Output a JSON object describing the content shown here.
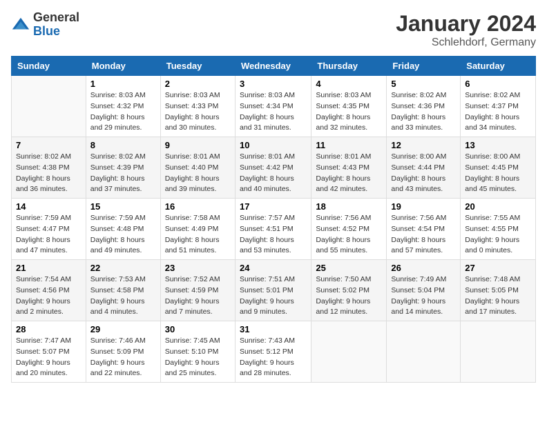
{
  "header": {
    "logo": {
      "general": "General",
      "blue": "Blue"
    },
    "title": "January 2024",
    "location": "Schlehdorf, Germany"
  },
  "days_of_week": [
    "Sunday",
    "Monday",
    "Tuesday",
    "Wednesday",
    "Thursday",
    "Friday",
    "Saturday"
  ],
  "weeks": [
    [
      {
        "day": "",
        "empty": true
      },
      {
        "day": "1",
        "sunrise": "8:03 AM",
        "sunset": "4:32 PM",
        "daylight": "8 hours and 29 minutes."
      },
      {
        "day": "2",
        "sunrise": "8:03 AM",
        "sunset": "4:33 PM",
        "daylight": "8 hours and 30 minutes."
      },
      {
        "day": "3",
        "sunrise": "8:03 AM",
        "sunset": "4:34 PM",
        "daylight": "8 hours and 31 minutes."
      },
      {
        "day": "4",
        "sunrise": "8:03 AM",
        "sunset": "4:35 PM",
        "daylight": "8 hours and 32 minutes."
      },
      {
        "day": "5",
        "sunrise": "8:02 AM",
        "sunset": "4:36 PM",
        "daylight": "8 hours and 33 minutes."
      },
      {
        "day": "6",
        "sunrise": "8:02 AM",
        "sunset": "4:37 PM",
        "daylight": "8 hours and 34 minutes."
      }
    ],
    [
      {
        "day": "7",
        "sunrise": "8:02 AM",
        "sunset": "4:38 PM",
        "daylight": "8 hours and 36 minutes."
      },
      {
        "day": "8",
        "sunrise": "8:02 AM",
        "sunset": "4:39 PM",
        "daylight": "8 hours and 37 minutes."
      },
      {
        "day": "9",
        "sunrise": "8:01 AM",
        "sunset": "4:40 PM",
        "daylight": "8 hours and 39 minutes."
      },
      {
        "day": "10",
        "sunrise": "8:01 AM",
        "sunset": "4:42 PM",
        "daylight": "8 hours and 40 minutes."
      },
      {
        "day": "11",
        "sunrise": "8:01 AM",
        "sunset": "4:43 PM",
        "daylight": "8 hours and 42 minutes."
      },
      {
        "day": "12",
        "sunrise": "8:00 AM",
        "sunset": "4:44 PM",
        "daylight": "8 hours and 43 minutes."
      },
      {
        "day": "13",
        "sunrise": "8:00 AM",
        "sunset": "4:45 PM",
        "daylight": "8 hours and 45 minutes."
      }
    ],
    [
      {
        "day": "14",
        "sunrise": "7:59 AM",
        "sunset": "4:47 PM",
        "daylight": "8 hours and 47 minutes."
      },
      {
        "day": "15",
        "sunrise": "7:59 AM",
        "sunset": "4:48 PM",
        "daylight": "8 hours and 49 minutes."
      },
      {
        "day": "16",
        "sunrise": "7:58 AM",
        "sunset": "4:49 PM",
        "daylight": "8 hours and 51 minutes."
      },
      {
        "day": "17",
        "sunrise": "7:57 AM",
        "sunset": "4:51 PM",
        "daylight": "8 hours and 53 minutes."
      },
      {
        "day": "18",
        "sunrise": "7:56 AM",
        "sunset": "4:52 PM",
        "daylight": "8 hours and 55 minutes."
      },
      {
        "day": "19",
        "sunrise": "7:56 AM",
        "sunset": "4:54 PM",
        "daylight": "8 hours and 57 minutes."
      },
      {
        "day": "20",
        "sunrise": "7:55 AM",
        "sunset": "4:55 PM",
        "daylight": "9 hours and 0 minutes."
      }
    ],
    [
      {
        "day": "21",
        "sunrise": "7:54 AM",
        "sunset": "4:56 PM",
        "daylight": "9 hours and 2 minutes."
      },
      {
        "day": "22",
        "sunrise": "7:53 AM",
        "sunset": "4:58 PM",
        "daylight": "9 hours and 4 minutes."
      },
      {
        "day": "23",
        "sunrise": "7:52 AM",
        "sunset": "4:59 PM",
        "daylight": "9 hours and 7 minutes."
      },
      {
        "day": "24",
        "sunrise": "7:51 AM",
        "sunset": "5:01 PM",
        "daylight": "9 hours and 9 minutes."
      },
      {
        "day": "25",
        "sunrise": "7:50 AM",
        "sunset": "5:02 PM",
        "daylight": "9 hours and 12 minutes."
      },
      {
        "day": "26",
        "sunrise": "7:49 AM",
        "sunset": "5:04 PM",
        "daylight": "9 hours and 14 minutes."
      },
      {
        "day": "27",
        "sunrise": "7:48 AM",
        "sunset": "5:05 PM",
        "daylight": "9 hours and 17 minutes."
      }
    ],
    [
      {
        "day": "28",
        "sunrise": "7:47 AM",
        "sunset": "5:07 PM",
        "daylight": "9 hours and 20 minutes."
      },
      {
        "day": "29",
        "sunrise": "7:46 AM",
        "sunset": "5:09 PM",
        "daylight": "9 hours and 22 minutes."
      },
      {
        "day": "30",
        "sunrise": "7:45 AM",
        "sunset": "5:10 PM",
        "daylight": "9 hours and 25 minutes."
      },
      {
        "day": "31",
        "sunrise": "7:43 AM",
        "sunset": "5:12 PM",
        "daylight": "9 hours and 28 minutes."
      },
      {
        "day": "",
        "empty": true
      },
      {
        "day": "",
        "empty": true
      },
      {
        "day": "",
        "empty": true
      }
    ]
  ],
  "labels": {
    "sunrise": "Sunrise:",
    "sunset": "Sunset:",
    "daylight": "Daylight:"
  }
}
